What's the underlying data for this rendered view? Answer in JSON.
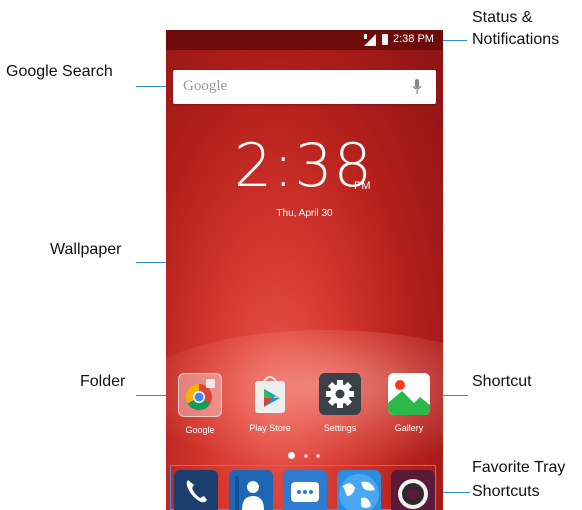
{
  "callouts": {
    "status": [
      "Status &",
      "Notifications"
    ],
    "google_search": "Google Search",
    "wallpaper": "Wallpaper",
    "folder": "Folder",
    "shortcut": "Shortcut",
    "favorite": [
      "Favorite Tray",
      "Shortcuts"
    ]
  },
  "status_bar": {
    "time": "2:38 PM"
  },
  "search": {
    "placeholder": "Google"
  },
  "clock": {
    "time": "2:38",
    "ampm": "PM",
    "date": "Thu, April 30"
  },
  "apps": [
    {
      "label": "Google",
      "icon": "chrome-folder-icon"
    },
    {
      "label": "Play Store",
      "icon": "play-store-icon"
    },
    {
      "label": "Settings",
      "icon": "gear-icon"
    },
    {
      "label": "Gallery",
      "icon": "gallery-icon"
    }
  ],
  "favorites": [
    "phone-icon",
    "contacts-icon",
    "messaging-icon",
    "browser-icon",
    "camera-icon"
  ],
  "colors": {
    "leader": "#2a8de0",
    "wallpaper": "#c02a24",
    "status_bar": "#6e0c0c"
  }
}
